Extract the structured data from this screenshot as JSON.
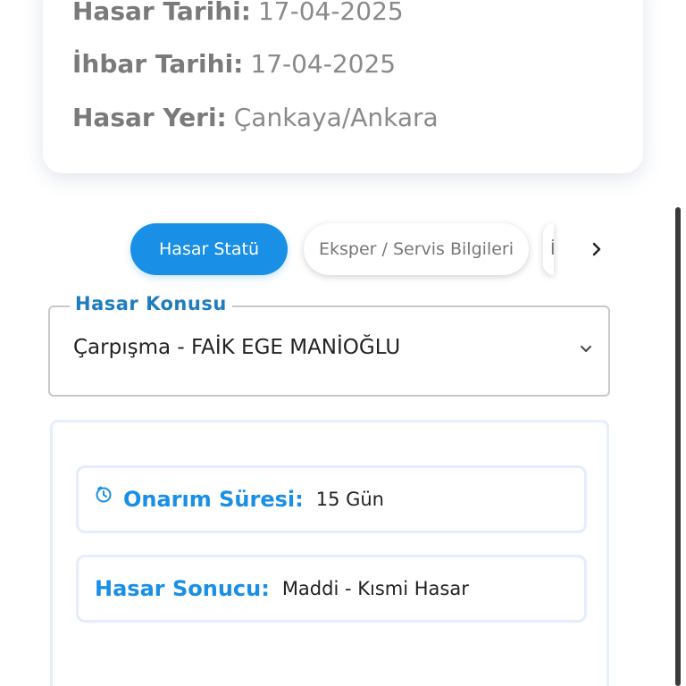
{
  "claim_info": {
    "damage_date_label": "Hasar Tarihi:",
    "damage_date_value": "17-04-2025",
    "notice_date_label": "İhbar Tarihi:",
    "notice_date_value": "17-04-2025",
    "damage_location_label": "Hasar Yeri:",
    "damage_location_value": "Çankaya/Ankara"
  },
  "tabs": [
    {
      "label": "Hasar Statü",
      "active": true
    },
    {
      "label": "Eksper / Servis Bilgileri",
      "active": false
    },
    {
      "label": "İ",
      "active": false
    }
  ],
  "icons": {
    "next": "chevron-right-icon",
    "select": "chevron-down-icon",
    "repair": "clock-icon"
  },
  "damage_subject": {
    "legend": "Hasar Konusu",
    "value": "Çarpışma - FAİK EGE MANİOĞLU"
  },
  "details": {
    "repair_duration_label": "Onarım Süresi:",
    "repair_duration_value": "15 Gün",
    "damage_result_label": "Hasar Sonucu:",
    "damage_result_value": "Maddi - Kısmi Hasar"
  },
  "colors": {
    "accent": "#1a8fe6",
    "legend": "#1f7dbf"
  }
}
